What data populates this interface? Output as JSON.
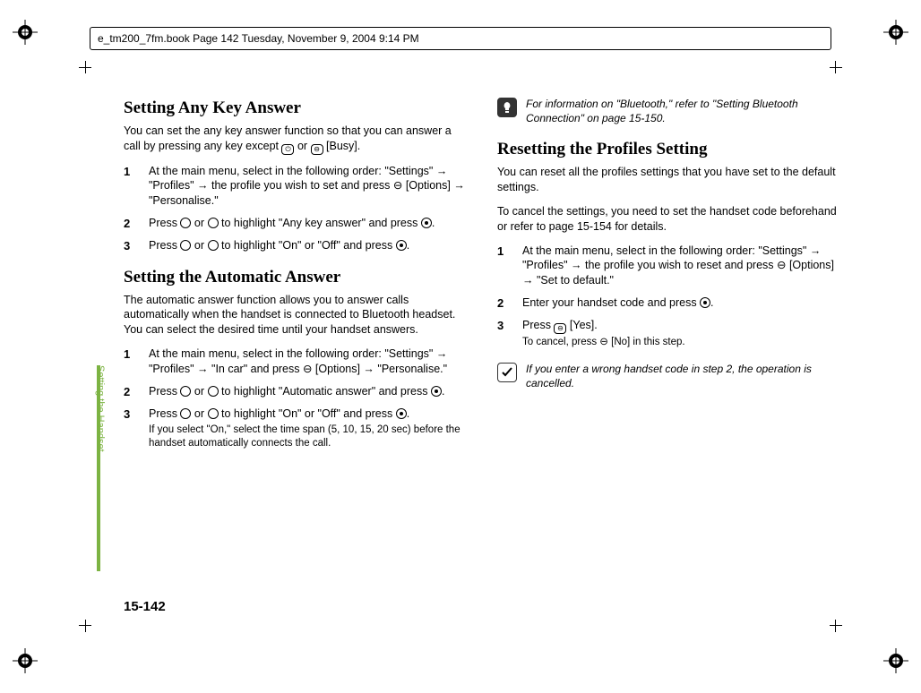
{
  "header": {
    "text": "e_tm200_7fm.book  Page 142  Tuesday, November 9, 2004  9:14 PM"
  },
  "sidetab": {
    "label": "Setting the Handset"
  },
  "pagenum": "15-142",
  "left": {
    "h1": "Setting Any Key Answer",
    "p1a": "You can set the any key answer function so that you can answer a call by pressing any key except ",
    "p1b": " or ",
    "p1c": " [Busy].",
    "s1": {
      "n1": "1",
      "t1": "At the main menu, select in the following order: \"Settings\" → \"Profiles\" → the profile you wish to set and press ⊖ [Options] → \"Personalise.\"",
      "n2": "2",
      "t2a": "Press ",
      "t2b": " or ",
      "t2c": " to highlight \"Any key answer\" and press ",
      "t2d": ".",
      "n3": "3",
      "t3a": "Press ",
      "t3b": " or ",
      "t3c": " to highlight \"On\" or \"Off\" and press ",
      "t3d": "."
    },
    "h2": "Setting the Automatic Answer",
    "p2": "The automatic answer function allows you to answer calls automatically when the handset is connected to Bluetooth headset. You can select the desired time until your handset answers.",
    "s2": {
      "n1": "1",
      "t1": "At the main menu, select in the following order: \"Settings\" → \"Profiles\" → \"In car\" and press ⊖ [Options] → \"Personalise.\"",
      "n2": "2",
      "t2a": "Press ",
      "t2b": " or ",
      "t2c": " to highlight \"Automatic answer\" and press ",
      "t2d": ".",
      "n3": "3",
      "t3a": "Press ",
      "t3b": " or ",
      "t3c": " to highlight \"On\" or \"Off\" and press ",
      "t3d": ".",
      "sub": "If you select \"On,\" select the time span (5, 10, 15, 20 sec) before the handset automatically connects the call."
    }
  },
  "right": {
    "note1": "For information on \"Bluetooth,\" refer to \"Setting Bluetooth Connection\" on page 15-150.",
    "h1": "Resetting the Profiles Setting",
    "p1": "You can reset all the profiles settings that you have set to the default settings.",
    "p2": "To cancel the settings, you need to set the handset code beforehand or refer to page 15-154 for details.",
    "s1": {
      "n1": "1",
      "t1": "At the main menu, select in the following order: \"Settings\" → \"Profiles\" → the profile you wish to reset and press ⊖ [Options] → \"Set to default.\"",
      "n2": "2",
      "t2a": "Enter your handset code and press ",
      "t2b": ".",
      "n3": "3",
      "t3a": "Press ",
      "t3b": " [Yes].",
      "sub": "To cancel, press ⊖ [No] in this step."
    },
    "note2": "If you enter a wrong handset code in step 2, the operation is cancelled."
  }
}
